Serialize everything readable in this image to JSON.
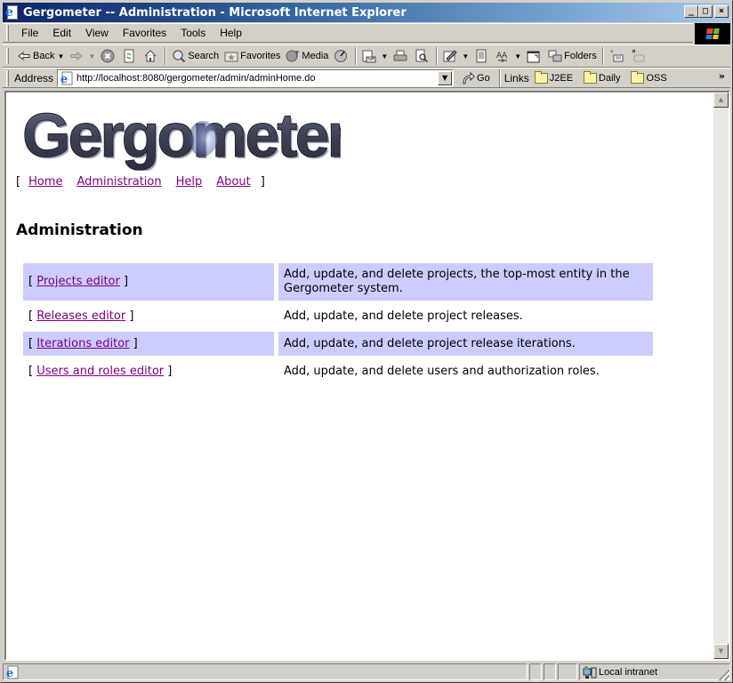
{
  "window": {
    "title": "Gergometer -- Administration - Microsoft Internet Explorer",
    "controls": {
      "minimize": "_",
      "maximize": "□",
      "close": "×"
    }
  },
  "menu": [
    "File",
    "Edit",
    "View",
    "Favorites",
    "Tools",
    "Help"
  ],
  "toolbar": {
    "back_label": "Back",
    "search_label": "Search",
    "favorites_label": "Favorites",
    "media_label": "Media",
    "folders_label": "Folders"
  },
  "address_bar": {
    "label": "Address",
    "url": "http://localhost:8080/gergometer/admin/adminHome.do",
    "go_label": "Go",
    "links_label": "Links",
    "links": [
      "J2EE",
      "Daily",
      "OSS"
    ],
    "more": "»"
  },
  "page": {
    "logo_text": "Gergometer",
    "nav": {
      "open_bracket": "[",
      "close_bracket": "]",
      "items": [
        "Home",
        "Administration",
        "Help",
        "About"
      ]
    },
    "heading": "Administration",
    "editors": [
      {
        "link": "Projects editor",
        "description": "Add, update, and delete projects, the top-most entity in the Gergometer system.",
        "highlighted": true
      },
      {
        "link": "Releases editor",
        "description": "Add, update, and delete project releases.",
        "highlighted": false
      },
      {
        "link": "Iterations editor",
        "description": "Add, update, and delete project release iterations.",
        "highlighted": true
      },
      {
        "link": "Users and roles editor",
        "description": "Add, update, and delete users and authorization roles.",
        "highlighted": false
      }
    ],
    "colors": {
      "row_highlight": "#ccccff",
      "visited_link": "#800080"
    }
  },
  "status_bar": {
    "message": "",
    "zone": "Local intranet"
  }
}
